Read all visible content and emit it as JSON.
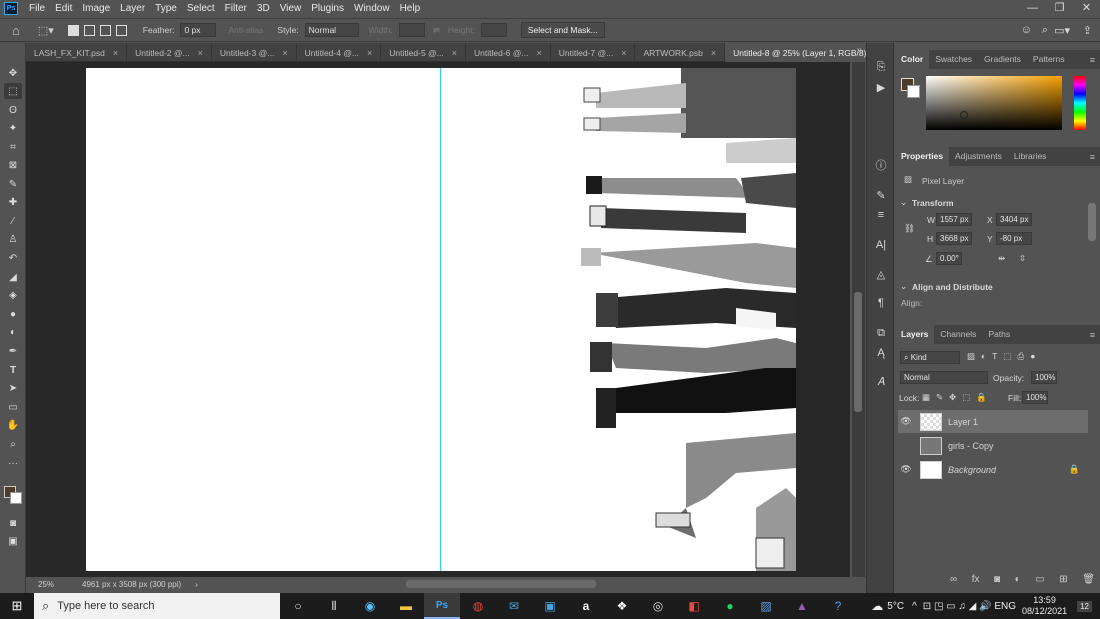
{
  "app": {
    "logo": "Ps"
  },
  "menu": [
    "File",
    "Edit",
    "Image",
    "Layer",
    "Type",
    "Select",
    "Filter",
    "3D",
    "View",
    "Plugins",
    "Window",
    "Help"
  ],
  "options": {
    "feather_label": "Feather:",
    "feather_value": "0 px",
    "antialias": "Anti-alias",
    "style_label": "Style:",
    "style_value": "Normal",
    "width_label": "Width:",
    "height_label": "Height:",
    "select_mask": "Select and Mask..."
  },
  "tabs": [
    "LASH_FX_KIT.psd",
    "Untitled-2 @...",
    "Untitled-3 @...",
    "Untitled-4 @...",
    "Untitled-5 @...",
    "Untitled-6 @...",
    "Untitled-7 @...",
    "ARTWORK.psb",
    "Untitled-8 @ 25% (Layer 1, RGB/8) *"
  ],
  "status": {
    "zoom": "25%",
    "doc_info": "4961 px x 3508 px (300 ppi)"
  },
  "color_panel": {
    "tabs": [
      "Color",
      "Swatches",
      "Gradients",
      "Patterns"
    ],
    "fg": "#4a3b2a",
    "bg": "#ffffff",
    "hue": "#f5a000"
  },
  "properties": {
    "tabs": [
      "Properties",
      "Adjustments",
      "Libraries"
    ],
    "kind": "Pixel Layer",
    "transform": "Transform",
    "w_label": "W",
    "w": "1557 px",
    "x_label": "X",
    "x": "3404 px",
    "h_label": "H",
    "h": "3668 px",
    "y_label": "Y",
    "y": "-80 px",
    "angle": "0.00°",
    "align": "Align and Distribute",
    "align_label": "Align:"
  },
  "layers": {
    "tabs": [
      "Layers",
      "Channels",
      "Paths"
    ],
    "kind": "Kind",
    "blend": "Normal",
    "opacity_label": "Opacity:",
    "opacity": "100%",
    "lock_label": "Lock:",
    "fill_label": "Fill:",
    "fill": "100%",
    "items": [
      {
        "name": "Layer 1",
        "visible": true,
        "selected": true
      },
      {
        "name": "girls - Copy",
        "visible": false,
        "selected": false
      },
      {
        "name": "Background",
        "visible": true,
        "selected": false
      }
    ]
  },
  "taskbar": {
    "search": "Type here to search",
    "weather": "5°C",
    "time": "13:59",
    "date": "08/12/2021",
    "notif": "12"
  }
}
